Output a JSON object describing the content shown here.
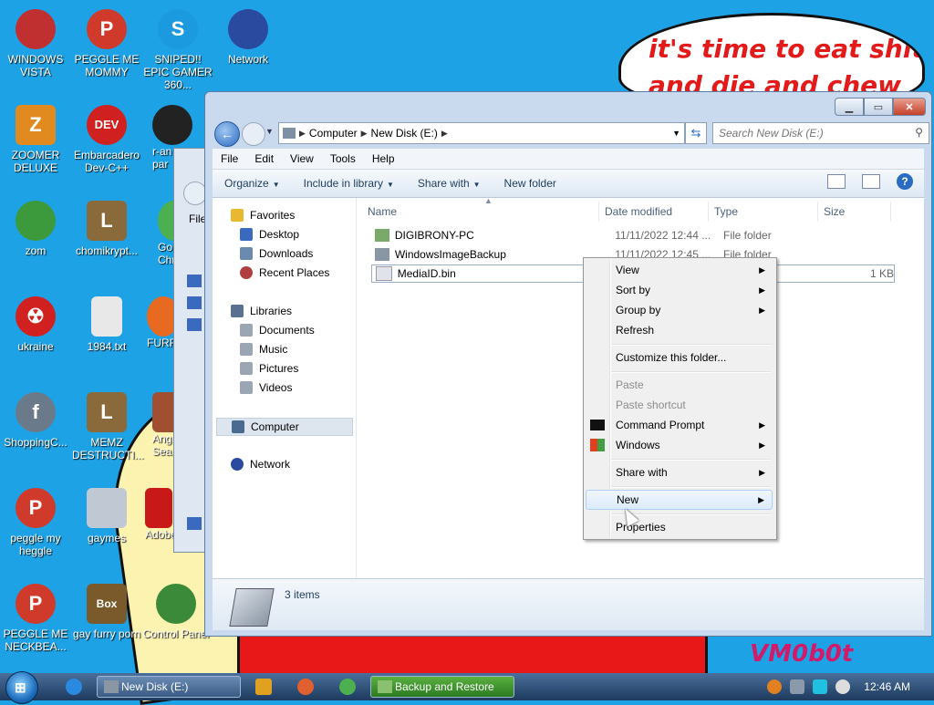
{
  "desktop": {
    "bubble_lines": [
      "it's time to eat shit",
      "and die and chew"
    ],
    "watermark": "VM0b0t",
    "icons": [
      {
        "label": "WINDOWS VISTA",
        "icon": "vista-icon",
        "color": "#c03030"
      },
      {
        "label": "PEGGLE ME MOMMY",
        "icon": "peggle-icon",
        "color": "#d03a2a"
      },
      {
        "label": "SNIPED!! EPIC GAMER 360...",
        "icon": "skype-icon",
        "color": "#1b9ae0"
      },
      {
        "label": "Network",
        "icon": "network-globe-icon",
        "color": "#2a4aa0"
      },
      {
        "label": "ZOOMER DELUXE",
        "icon": "zoomer-icon",
        "color": "#e08a20"
      },
      {
        "label": "Embarcadero Dev-C++",
        "icon": "devcpp-icon",
        "color": "#d02020"
      },
      {
        "label": "r-an par",
        "icon": "app-icon",
        "color": "#222222"
      },
      {
        "label": "zom",
        "icon": "plant-icon",
        "color": "#3c9a3c"
      },
      {
        "label": "chomikrypt...",
        "icon": "installer-icon",
        "color": "#8a6a3a"
      },
      {
        "label": "Go Chr",
        "icon": "chrome-icon",
        "color": "#4caf50"
      },
      {
        "label": "ukraine",
        "icon": "radiation-icon",
        "color": "#d02020"
      },
      {
        "label": "1984.txt",
        "icon": "text-file-icon",
        "color": "#e8e8e8"
      },
      {
        "label": "FURRY",
        "icon": "firefox-icon",
        "color": "#e86a20"
      },
      {
        "label": "ShoppingC...",
        "icon": "flash-icon",
        "color": "#6a7a8a"
      },
      {
        "label": "MEMZ DESTRUCTI...",
        "icon": "installer-icon",
        "color": "#8a6a3a"
      },
      {
        "label": "Angr Sea",
        "icon": "app-icon",
        "color": "#a05030"
      },
      {
        "label": "peggle my heggle",
        "icon": "peggle-icon",
        "color": "#d03a2a"
      },
      {
        "label": "gaymes",
        "icon": "folder-icon",
        "color": "#c0c8d4"
      },
      {
        "label": "Adobe",
        "icon": "adobe-icon",
        "color": "#c81818"
      },
      {
        "label": "PEGGLE ME NECKBEA...",
        "icon": "peggle-icon",
        "color": "#d03a2a"
      },
      {
        "label": "gay furry porn",
        "icon": "box-icon",
        "color": "#7a5a2a"
      },
      {
        "label": "Control Panel",
        "icon": "control-panel-icon",
        "color": "#3a8a3a"
      }
    ],
    "box_badge": "Box"
  },
  "background_window": {
    "label": "File"
  },
  "window": {
    "address": [
      "Computer",
      "New Disk (E:)"
    ],
    "search_placeholder": "Search New Disk (E:)",
    "menu": [
      "File",
      "Edit",
      "View",
      "Tools",
      "Help"
    ],
    "commands": [
      {
        "label": "Organize",
        "dropdown": true
      },
      {
        "label": "Include in library",
        "dropdown": true
      },
      {
        "label": "Share with",
        "dropdown": true
      },
      {
        "label": "New folder",
        "dropdown": false
      }
    ],
    "nav": {
      "favorites": "Favorites",
      "favorite_items": [
        "Desktop",
        "Downloads",
        "Recent Places"
      ],
      "libraries": "Libraries",
      "library_items": [
        "Documents",
        "Music",
        "Pictures",
        "Videos"
      ],
      "computer": "Computer",
      "network": "Network"
    },
    "columns": [
      "Name",
      "Date modified",
      "Type",
      "Size"
    ],
    "files": [
      {
        "name": "DIGIBRONY-PC",
        "date": "11/11/2022 12:44 ...",
        "type": "File folder",
        "size": ""
      },
      {
        "name": "WindowsImageBackup",
        "date": "11/11/2022 12:45 ...",
        "type": "File folder",
        "size": ""
      },
      {
        "name": "MediaID.bin",
        "date": "",
        "type": "",
        "size": "1 KB"
      }
    ],
    "status": "3 items"
  },
  "context_menu": {
    "items": [
      {
        "label": "View",
        "submenu": true,
        "disabled": false
      },
      {
        "label": "Sort by",
        "submenu": true,
        "disabled": false
      },
      {
        "label": "Group by",
        "submenu": true,
        "disabled": false
      },
      {
        "label": "Refresh",
        "submenu": false,
        "disabled": false
      },
      {
        "label": "Customize this folder...",
        "submenu": false,
        "disabled": false
      },
      {
        "label": "Paste",
        "submenu": false,
        "disabled": true
      },
      {
        "label": "Paste shortcut",
        "submenu": false,
        "disabled": true
      },
      {
        "label": "Command Prompt",
        "submenu": true,
        "disabled": false
      },
      {
        "label": "Windows",
        "submenu": true,
        "disabled": false
      },
      {
        "label": "Share with",
        "submenu": true,
        "disabled": false
      },
      {
        "label": "New",
        "submenu": true,
        "disabled": false
      },
      {
        "label": "Properties",
        "submenu": false,
        "disabled": false
      }
    ],
    "highlighted": "New"
  },
  "taskbar": {
    "tasks": [
      "New Disk (E:)",
      "Backup and Restore"
    ],
    "clock": "12:46 AM"
  }
}
